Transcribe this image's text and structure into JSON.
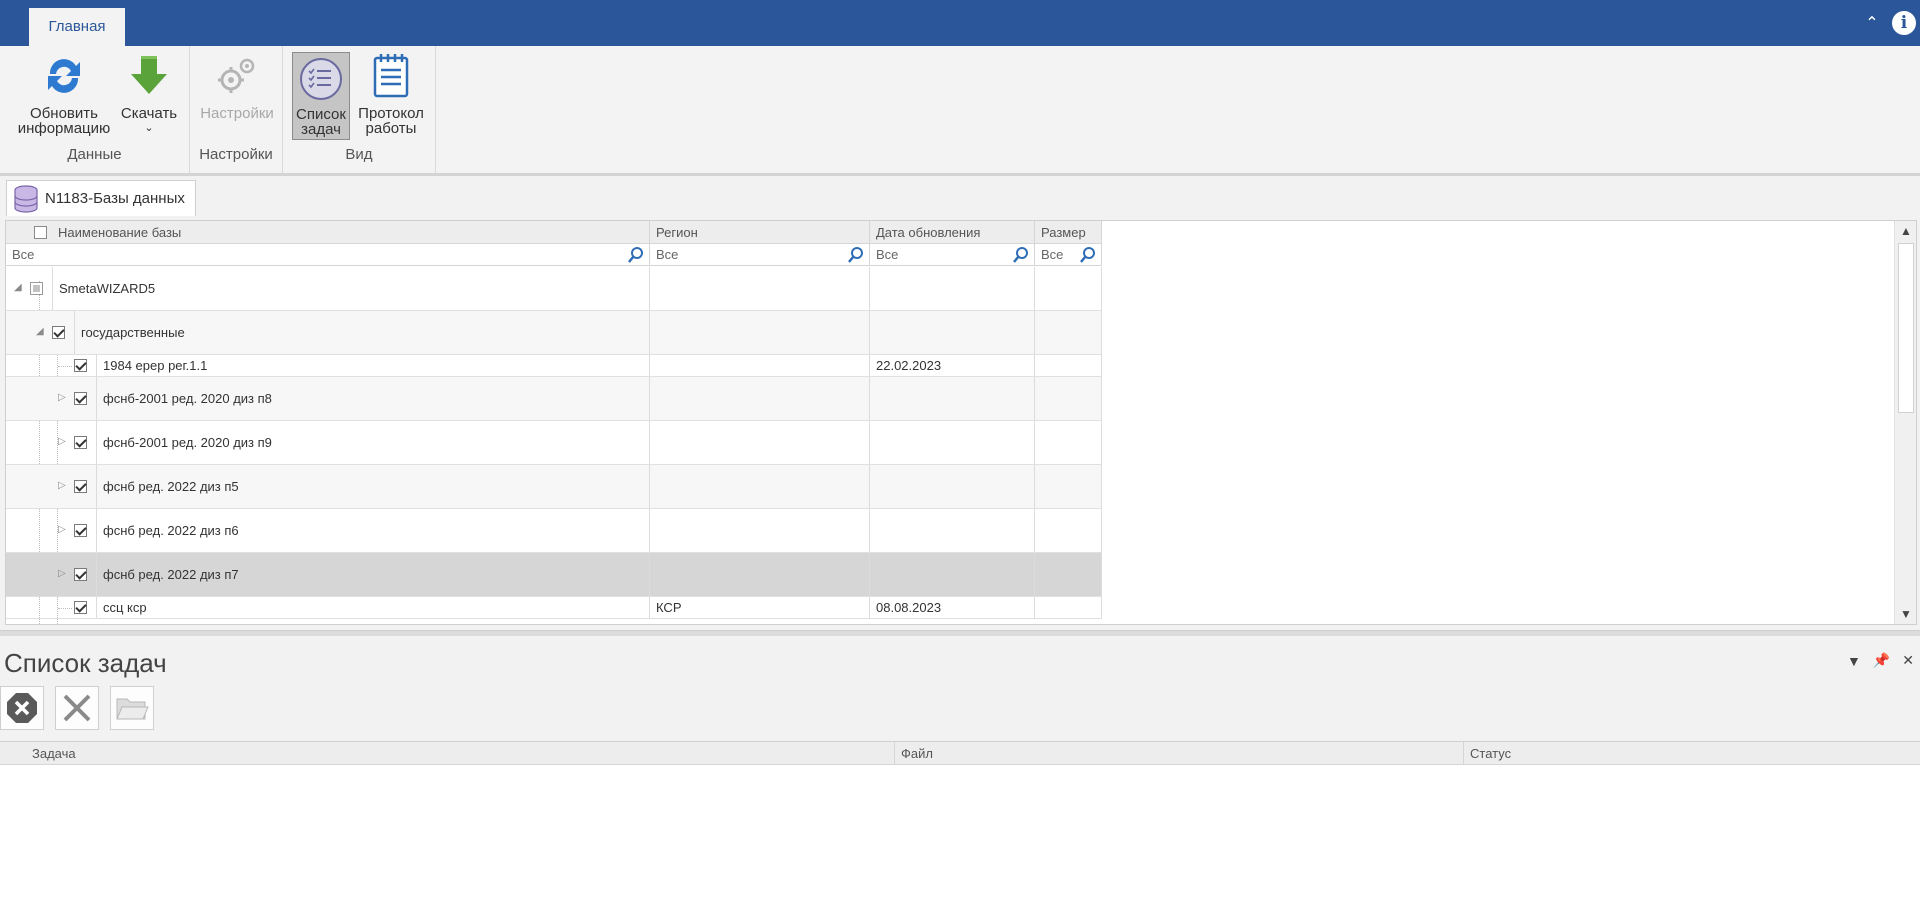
{
  "ribbon": {
    "tab_label": "Главная",
    "groups": {
      "data_label": "Данные",
      "settings_label": "Настройки",
      "view_label": "Вид"
    },
    "buttons": {
      "refresh_line1": "Обновить",
      "refresh_line2": "информацию",
      "download_label": "Скачать",
      "settings_label": "Настройки",
      "tasklist_line1": "Список",
      "tasklist_line2": "задач",
      "protocol_line1": "Протокол",
      "protocol_line2": "работы"
    }
  },
  "document": {
    "tab_label": "N1183-Базы данных"
  },
  "grid": {
    "columns": [
      "Наименование базы",
      "Регион",
      "Дата обновления",
      "Размер"
    ],
    "filter_placeholder": "Все",
    "rows": [
      {
        "level": 0,
        "name": "SmetaWIZARD5",
        "region": "",
        "date": "",
        "size": "",
        "check": "indeterminate",
        "expander": "expanded"
      },
      {
        "level": 1,
        "name": "государственные",
        "region": "",
        "date": "",
        "size": "",
        "check": "checked",
        "expander": "expanded"
      },
      {
        "level": 2,
        "name": "1984 ерер рег.1.1",
        "region": "",
        "date": "22.02.2023",
        "size": "",
        "check": "checked",
        "expander": "none"
      },
      {
        "level": 2,
        "name": "фснб-2001 ред. 2020 диз п8",
        "region": "",
        "date": "",
        "size": "",
        "check": "checked",
        "expander": "collapsed"
      },
      {
        "level": 2,
        "name": "фснб-2001 ред. 2020 диз п9",
        "region": "",
        "date": "",
        "size": "",
        "check": "checked",
        "expander": "collapsed"
      },
      {
        "level": 2,
        "name": "фснб ред. 2022 диз п5",
        "region": "",
        "date": "",
        "size": "",
        "check": "checked",
        "expander": "collapsed"
      },
      {
        "level": 2,
        "name": "фснб ред. 2022 диз п6",
        "region": "",
        "date": "",
        "size": "",
        "check": "checked",
        "expander": "collapsed"
      },
      {
        "level": 2,
        "name": "фснб ред. 2022 диз п7",
        "region": "",
        "date": "",
        "size": "",
        "check": "checked",
        "expander": "collapsed"
      },
      {
        "level": 2,
        "name": "ссц ксp",
        "region": "КСР",
        "date": "08.08.2023",
        "size": "",
        "check": "checked",
        "expander": "none"
      }
    ]
  },
  "task_panel": {
    "title": "Список задач",
    "columns": [
      "Задача",
      "Файл",
      "Статус"
    ]
  },
  "colors": {
    "header_blue": "#2b579a",
    "selected_row": "#d6d6d6",
    "ribbon_bg": "#f3f3f3"
  }
}
